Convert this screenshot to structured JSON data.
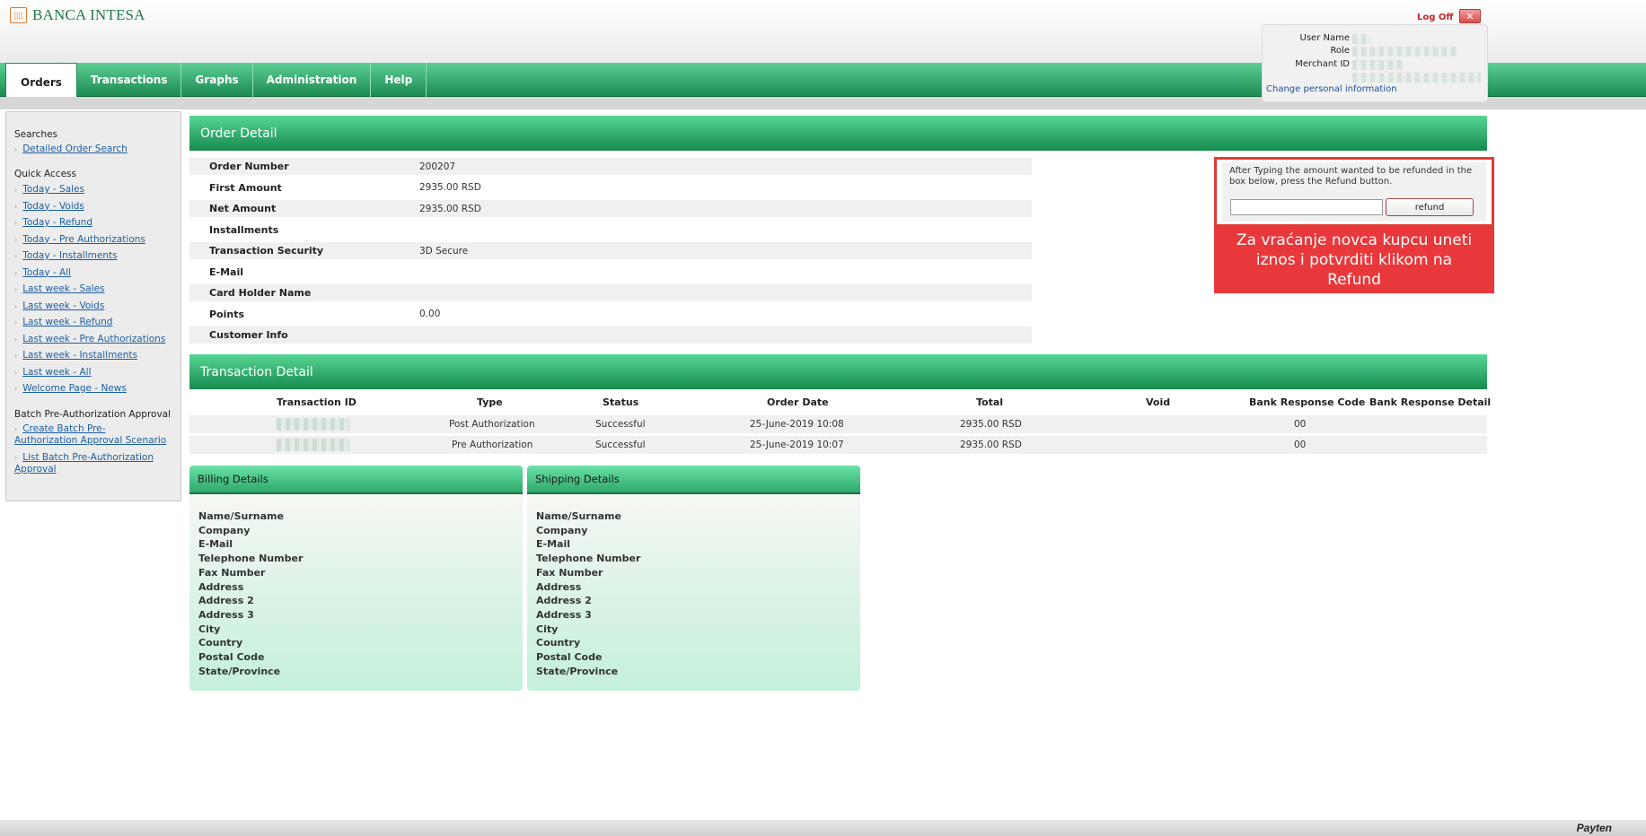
{
  "header": {
    "logo_text": "BANCA INTESA",
    "logoff": "Log Off",
    "close_glyph": "✕"
  },
  "nav": {
    "tabs": [
      "Orders",
      "Transactions",
      "Graphs",
      "Administration",
      "Help"
    ],
    "active": "Orders"
  },
  "user_panel": {
    "user_name_label": "User Name",
    "role_label": "Role",
    "merchant_id_label": "Merchant ID",
    "change_info": "Change personal information"
  },
  "sidebar": {
    "searches_title": "Searches",
    "searches": [
      "Detailed Order Search"
    ],
    "quick_title": "Quick Access",
    "quick": [
      "Today - Sales",
      "Today - Voids",
      "Today - Refund",
      "Today - Pre Authorizations",
      "Today - Installments",
      "Today - All",
      "Last week - Sales",
      "Last week - Voids",
      "Last week - Refund",
      "Last week - Pre Authorizations",
      "Last week - Installments",
      "Last week - All",
      "Welcome Page - News"
    ],
    "batch_title": "Batch Pre-Authorization Approval",
    "batch_create": "Create Batch Pre-Authorization Approval Scenario",
    "batch_list": "List Batch Pre-Authorization Approval"
  },
  "order_detail": {
    "title": "Order Detail",
    "rows": [
      {
        "label": "Order Number",
        "value": "200207"
      },
      {
        "label": "First Amount",
        "value": "2935.00 RSD"
      },
      {
        "label": "Net Amount",
        "value": "2935.00 RSD"
      },
      {
        "label": "Installments",
        "value": ""
      },
      {
        "label": "Transaction Security",
        "value": "3D Secure"
      },
      {
        "label": "E-Mail",
        "value": ""
      },
      {
        "label": "Card Holder Name",
        "value": ""
      },
      {
        "label": "Points",
        "value": "0.00"
      },
      {
        "label": "Customer Info",
        "value": ""
      }
    ]
  },
  "refund": {
    "instructions": "After Typing the amount wanted to be refunded in the box below, press the Refund button.",
    "input_value": "",
    "button": "refund",
    "callout": "Za vraćanje novca kupcu uneti iznos i potvrditi klikom na Refund"
  },
  "transaction_detail": {
    "title": "Transaction Detail",
    "columns": [
      "Transaction ID",
      "Type",
      "Status",
      "Order Date",
      "Total",
      "Void",
      "Bank Response Code",
      "Bank Response Detail"
    ],
    "rows": [
      {
        "type": "Post Authorization",
        "status": "Successful",
        "date": "25-June-2019 10:08",
        "total": "2935.00 RSD",
        "void": "",
        "code": "00",
        "detail": ""
      },
      {
        "type": "Pre Authorization",
        "status": "Successful",
        "date": "25-June-2019 10:07",
        "total": "2935.00 RSD",
        "void": "",
        "code": "00",
        "detail": ""
      }
    ]
  },
  "billing": {
    "title": "Billing Details",
    "labels": [
      "Name/Surname",
      "Company",
      "E-Mail",
      "Telephone Number",
      "Fax Number",
      "Address",
      "Address 2",
      "Address 3",
      "City",
      "Country",
      "Postal Code",
      "State/Province"
    ]
  },
  "shipping": {
    "title": "Shipping Details",
    "labels": [
      "Name/Surname",
      "Company",
      "E-Mail",
      "Telephone Number",
      "Fax Number",
      "Address",
      "Address 2",
      "Address 3",
      "City",
      "Country",
      "Postal Code",
      "State/Province"
    ]
  },
  "footer": {
    "brand": "Payten"
  }
}
